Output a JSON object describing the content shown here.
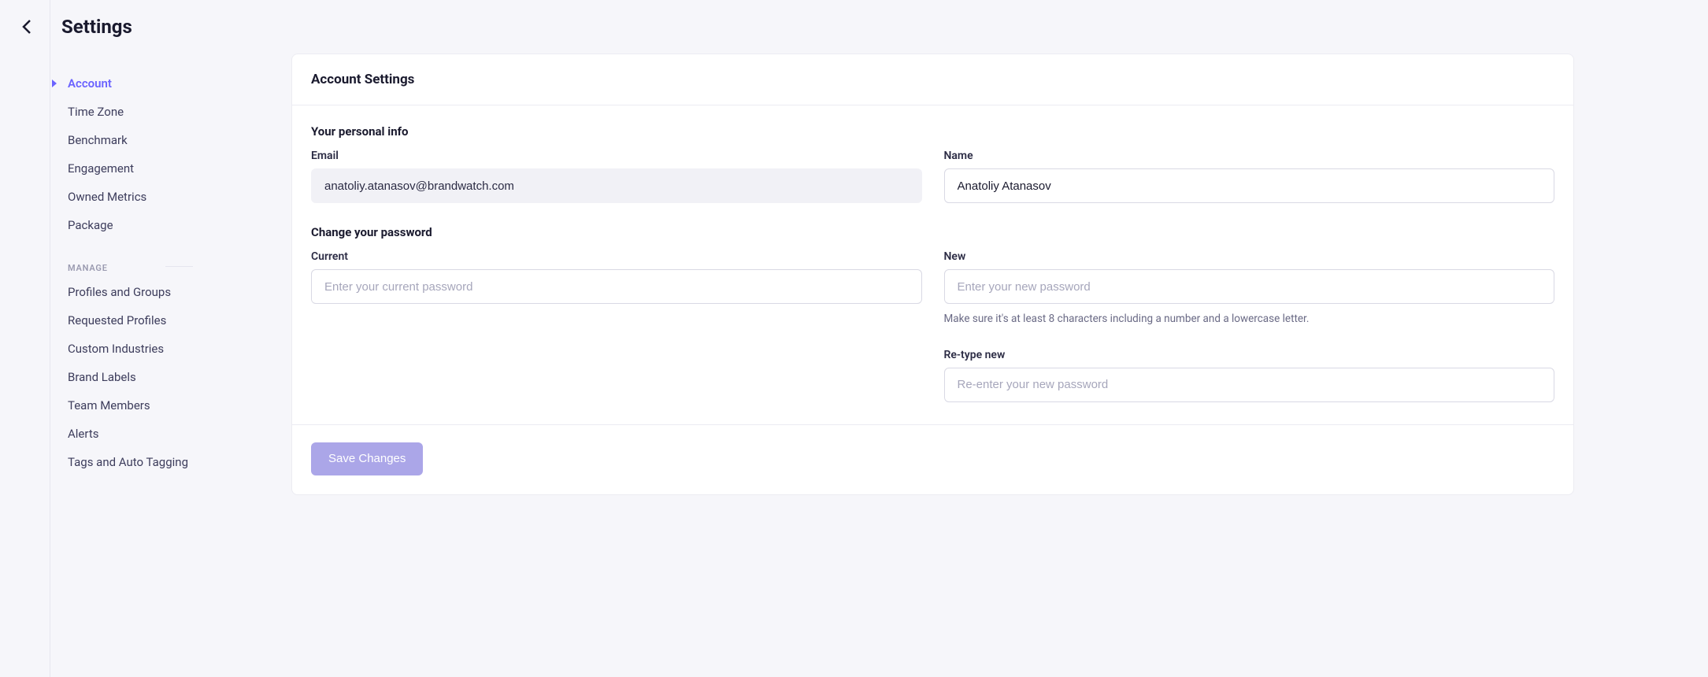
{
  "header": {
    "title": "Settings"
  },
  "sidebar": {
    "primary": [
      {
        "label": "Account",
        "active": true
      },
      {
        "label": "Time Zone",
        "active": false
      },
      {
        "label": "Benchmark",
        "active": false
      },
      {
        "label": "Engagement",
        "active": false
      },
      {
        "label": "Owned Metrics",
        "active": false
      },
      {
        "label": "Package",
        "active": false
      }
    ],
    "manage_header": "MANAGE",
    "manage": [
      {
        "label": "Profiles and Groups"
      },
      {
        "label": "Requested Profiles"
      },
      {
        "label": "Custom Industries"
      },
      {
        "label": "Brand Labels"
      },
      {
        "label": "Team Members"
      },
      {
        "label": "Alerts"
      },
      {
        "label": "Tags and Auto Tagging"
      }
    ]
  },
  "card": {
    "title": "Account Settings",
    "section_personal": "Your personal info",
    "email_label": "Email",
    "email_value": "anatoliy.atanasov@brandwatch.com",
    "name_label": "Name",
    "name_value": "Anatoliy Atanasov",
    "section_password": "Change your password",
    "current_label": "Current",
    "current_placeholder": "Enter your current password",
    "new_label": "New",
    "new_placeholder": "Enter your new password",
    "new_helper": "Make sure it's at least 8 characters including a number and a lowercase letter.",
    "retype_label": "Re-type new",
    "retype_placeholder": "Re-enter your new password",
    "save_label": "Save Changes"
  }
}
